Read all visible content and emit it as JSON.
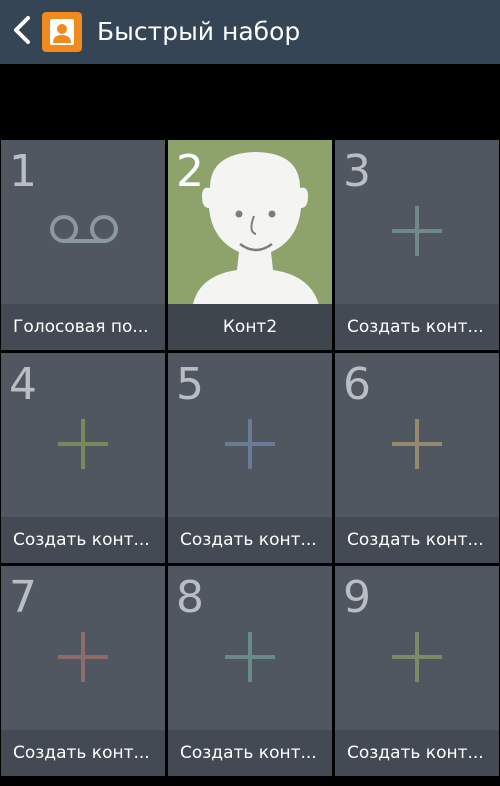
{
  "header": {
    "title": "Быстрый набор",
    "back_icon": "chevron-left-icon",
    "app_icon": "contacts-icon",
    "app_icon_color": "#f08a1c",
    "background_color": "#364556"
  },
  "tiles": [
    {
      "number": "1",
      "label": "Голосовая по...",
      "icon": "voicemail-icon"
    },
    {
      "number": "2",
      "label": "Конт2",
      "icon": "contact-avatar-icon"
    },
    {
      "number": "3",
      "label": "Создать конт...",
      "icon": "plus-icon",
      "icon_color": "#6f8a86"
    },
    {
      "number": "4",
      "label": "Создать конт...",
      "icon": "plus-icon",
      "icon_color": "#788a5c"
    },
    {
      "number": "5",
      "label": "Создать конт...",
      "icon": "plus-icon",
      "icon_color": "#6a7b95"
    },
    {
      "number": "6",
      "label": "Создать конт...",
      "icon": "plus-icon",
      "icon_color": "#948b6e"
    },
    {
      "number": "7",
      "label": "Создать конт...",
      "icon": "plus-icon",
      "icon_color": "#8c6c6a"
    },
    {
      "number": "8",
      "label": "Создать конт...",
      "icon": "plus-icon",
      "icon_color": "#6a8a88"
    },
    {
      "number": "9",
      "label": "Создать конт...",
      "icon": "plus-icon",
      "icon_color": "#7c8a68"
    }
  ]
}
